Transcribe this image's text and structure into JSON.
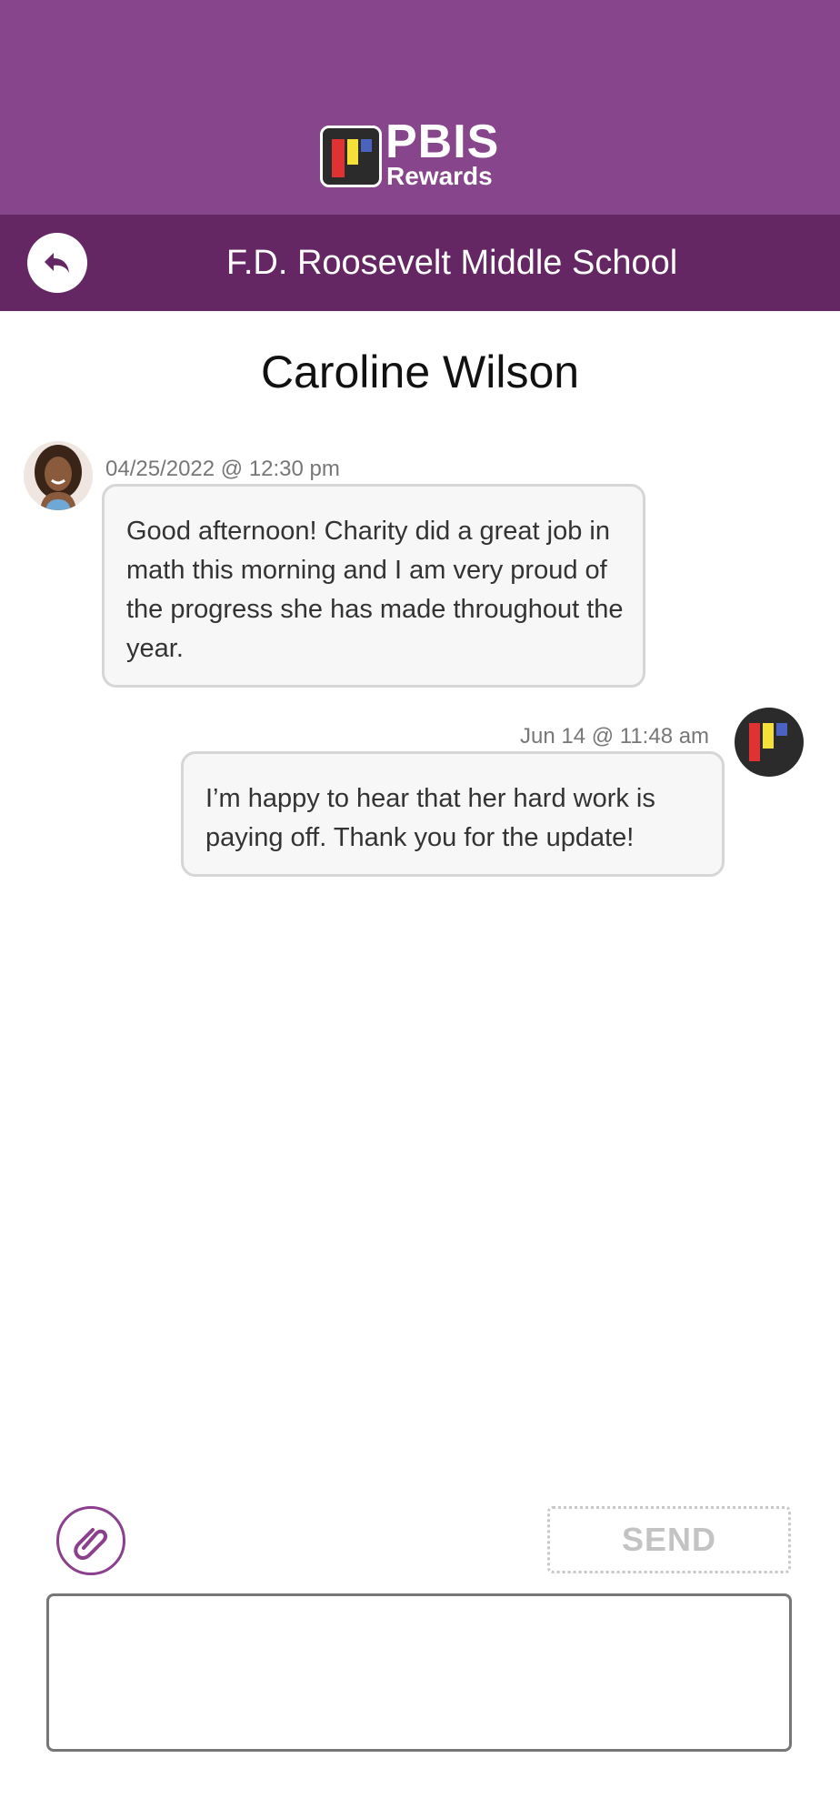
{
  "header": {
    "logo": {
      "title": "PBIS",
      "subtitle": "Rewards"
    },
    "school_name": "F.D. Roosevelt Middle School"
  },
  "conversation": {
    "contact_name": "Caroline Wilson",
    "messages": [
      {
        "sender": "teacher",
        "timestamp": "04/25/2022 @ 12:30 pm",
        "text": "Good afternoon!  Charity did a great job in math this morning and I am very proud of the progress she has made throughout the year."
      },
      {
        "sender": "me",
        "timestamp": "Jun 14 @ 11:48 am",
        "text": "I’m happy to hear that her hard work is paying off. Thank you for the update!"
      }
    ]
  },
  "composer": {
    "send_label": "SEND",
    "input_value": ""
  },
  "colors": {
    "brand_purple": "#87458b",
    "brand_dark_purple": "#652764",
    "bubble_border": "#d6d6d6"
  }
}
